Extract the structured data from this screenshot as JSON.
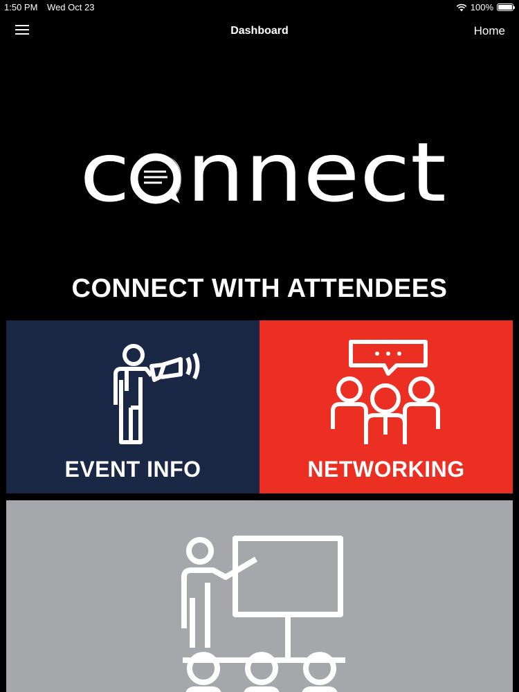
{
  "status_bar": {
    "time": "1:50 PM",
    "date": "Wed Oct 23",
    "battery": "100%",
    "battery_level": 1.0
  },
  "nav": {
    "title": "Dashboard",
    "home_label": "Home",
    "menu_icon": "hamburger-icon"
  },
  "logo": {
    "text": "connect",
    "icon": "chat-bubble-icon"
  },
  "headline": "CONNECT WITH ATTENDEES",
  "tiles": [
    {
      "label": "EVENT INFO",
      "icon": "megaphone-person-icon",
      "color": "#1a2745"
    },
    {
      "label": "NETWORKING",
      "icon": "group-chat-icon",
      "color": "#ec2f23"
    },
    {
      "label": "",
      "icon": "presenter-audience-icon",
      "color": "#a6a7ab"
    }
  ]
}
